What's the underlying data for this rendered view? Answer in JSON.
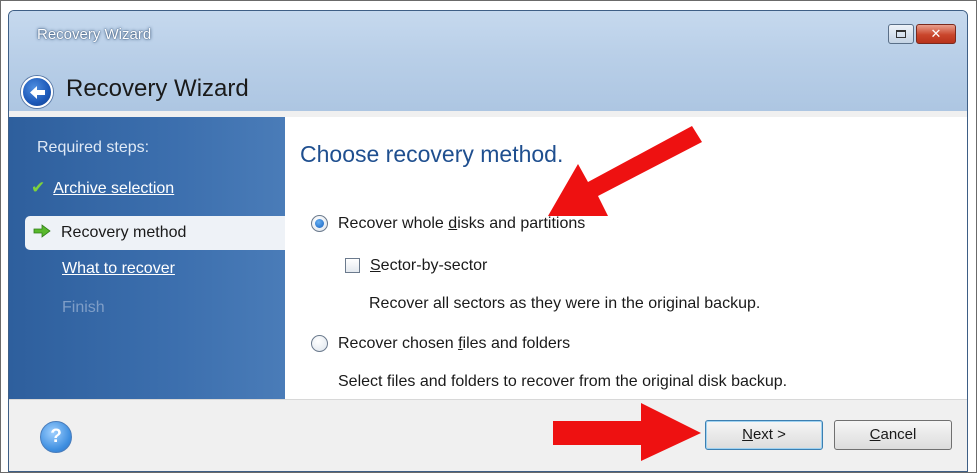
{
  "window": {
    "titlebar_text": "Recovery Wizard",
    "close_glyph": "✕"
  },
  "header": {
    "title": "Recovery Wizard"
  },
  "sidebar": {
    "heading": "Required steps:",
    "steps": [
      {
        "label": "Archive selection",
        "state": "done"
      },
      {
        "label": "Recovery method",
        "state": "current"
      },
      {
        "label": "What to recover",
        "state": "pending"
      },
      {
        "label": "Finish",
        "state": "disabled"
      }
    ]
  },
  "main": {
    "title": "Choose recovery method.",
    "option_disks": {
      "label": "Recover whole disks and partitions",
      "selected": true
    },
    "sector_by_sector": {
      "label": "Sector-by-sector",
      "checked": false,
      "description": "Recover all sectors as they were in the original backup."
    },
    "option_files": {
      "label": "Recover chosen files and folders",
      "selected": false,
      "description": "Select files and folders to recover from the original disk backup."
    }
  },
  "footer": {
    "help_glyph": "?",
    "next_label": "Next >",
    "cancel_label": "Cancel"
  },
  "colors": {
    "sidebar_blue": "#2e5f9d",
    "title_blue": "#1f4f8f",
    "annotation_red": "#ee1111"
  },
  "icons": [
    "back-arrow-icon",
    "check-icon",
    "green-arrow-icon",
    "help-icon",
    "restore-icon",
    "close-icon"
  ]
}
